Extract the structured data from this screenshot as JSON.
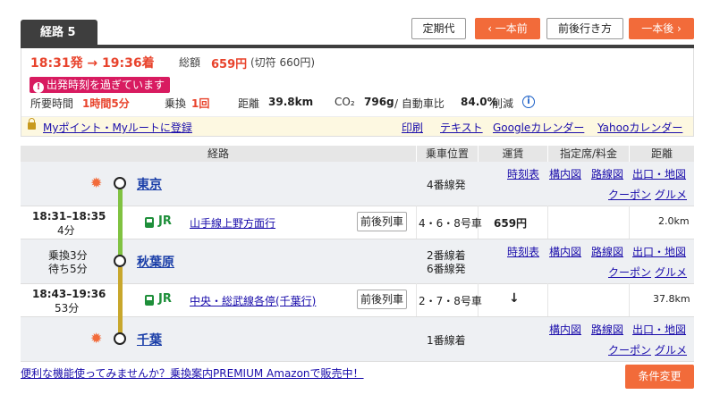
{
  "route": {
    "tab_label": "経路 5",
    "commuter_pass": "定期代",
    "prev": "‹ 一本前",
    "around": "前後行き方",
    "next": "一本後 ›"
  },
  "summary": {
    "dep_arr": "18:31発 → 19:36着",
    "fare_label": "総額",
    "fare_value": "659円",
    "fare_note": "(切符 660円)",
    "warning": "出発時刻を過ぎています",
    "duration_label": "所要時間",
    "duration_value": "1時間5分",
    "transfer_label": "乗換",
    "transfer_value": "1回",
    "distance_label": "距離",
    "distance_value": "39.8km",
    "co2_label": "CO₂",
    "co2_value": "796g",
    "co2_compare": "/ 自動車比",
    "co2_pct": "84.0%",
    "co2_tail": "削減"
  },
  "links": {
    "myroute": "Myポイント・Myルートに登録",
    "print": "印刷",
    "text": "テキスト",
    "google": "Googleカレンダー",
    "yahoo": "Yahooカレンダー"
  },
  "table": {
    "headers": [
      "経路",
      "乗車位置",
      "運賃",
      "指定席/料金",
      "距離"
    ]
  },
  "stations": [
    {
      "name": "東京",
      "platform": "4番線発",
      "links": [
        "時刻表",
        "構内図",
        "路線図",
        "出口・地図",
        "クーポン",
        "グルメ"
      ]
    },
    {
      "name": "秋葉原",
      "transfer": "乗換3分",
      "wait": "待ち5分",
      "platform1": "2番線着",
      "platform2": "6番線発",
      "links": [
        "時刻表",
        "構内図",
        "路線図",
        "出口・地図",
        "クーポン",
        "グルメ"
      ]
    },
    {
      "name": "千葉",
      "platform": "1番線着",
      "links": [
        "構内図",
        "路線図",
        "出口・地図",
        "クーポン",
        "グルメ"
      ]
    }
  ],
  "legs": [
    {
      "time": "18:31–18:35",
      "dur": "4分",
      "company": "JR",
      "line": "山手線上野方面行",
      "btn": "前後列車",
      "cars": "4・6・8号車",
      "fare": "659円",
      "dist": "2.0km"
    },
    {
      "time": "18:43–19:36",
      "dur": "53分",
      "company": "JR",
      "line": "中央・総武線各停(千葉行)",
      "btn": "前後列車",
      "cars": "2・7・8号車",
      "fare": "↓",
      "dist": "37.8km"
    }
  ],
  "line_colors": {
    "yamanote": "#80c241",
    "sobu": "#c8a72c"
  },
  "footer": {
    "promo": "便利な機能使ってみませんか？乗換案内PREMIUM Amazonで販売中！",
    "condition": "条件変更"
  }
}
